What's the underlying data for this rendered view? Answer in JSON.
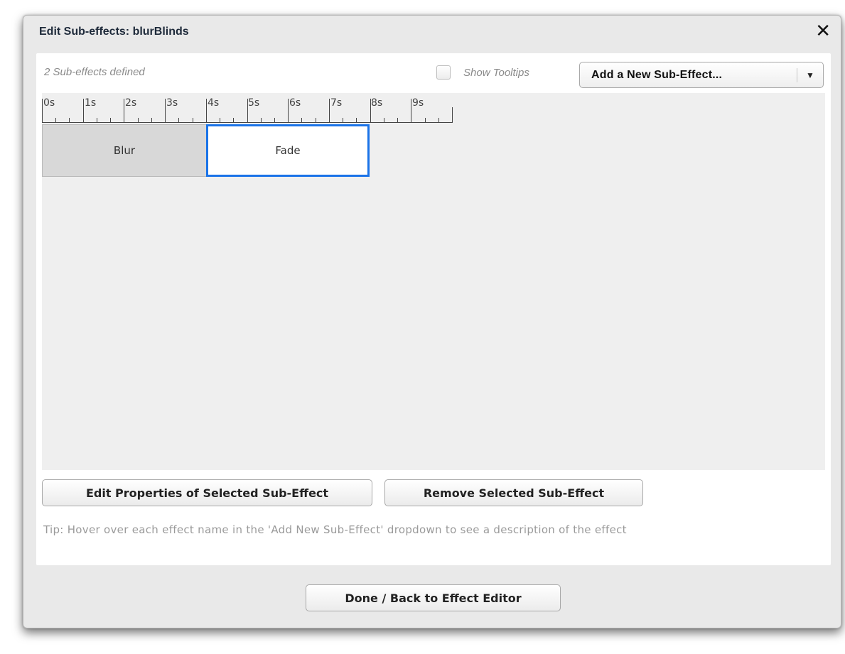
{
  "dialog": {
    "title": "Edit Sub-effects: blurBlinds",
    "close_glyph": "✕"
  },
  "panel": {
    "count_text": "2 Sub-effects defined",
    "show_tooltips_label": "Show Tooltips",
    "show_tooltips_checked": false,
    "add_select": {
      "label": "Add a New Sub-Effect...",
      "arrow_glyph": "▼"
    }
  },
  "timeline": {
    "ruler_labels": [
      "0s",
      "1s",
      "2s",
      "3s",
      "4s",
      "5s",
      "6s",
      "7s",
      "8s",
      "9s"
    ],
    "clips": [
      {
        "label": "Blur",
        "selected": false
      },
      {
        "label": "Fade",
        "selected": true
      }
    ]
  },
  "actions": {
    "edit_label": "Edit Properties of Selected Sub-Effect",
    "remove_label": "Remove Selected Sub-Effect"
  },
  "tip": "Tip: Hover over each effect name in the 'Add New Sub-Effect' dropdown to see a description of the effect",
  "footer": {
    "done_label": "Done / Back to Effect Editor"
  },
  "colors": {
    "selection_border": "#1a73e8",
    "clip_unselected_bg": "#d8d8d8",
    "dialog_bg": "#e9e9e9"
  },
  "icons": {
    "close": "close-icon",
    "dropdown": "chevron-down-icon",
    "checkbox": "checkbox-icon"
  }
}
